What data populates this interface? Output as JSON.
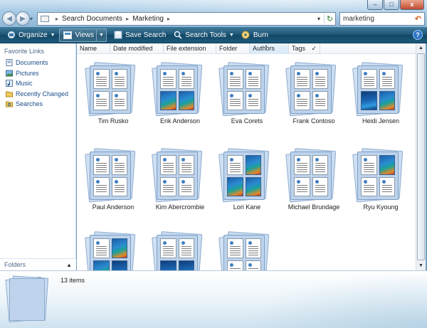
{
  "window": {
    "minimize": "–",
    "maximize": "□",
    "close": "x"
  },
  "address": {
    "crumbs": [
      "Search Documents",
      "Marketing"
    ],
    "separator": "▸"
  },
  "search": {
    "value": "marketing",
    "clear_glyph": "↶"
  },
  "toolbar": {
    "organize": "Organize",
    "views": "Views",
    "save_search": "Save Search",
    "search_tools": "Search Tools",
    "burn": "Burn",
    "help": "?"
  },
  "nav": {
    "header": "Favorite Links",
    "items": [
      {
        "label": "Documents",
        "icon": "documents-icon"
      },
      {
        "label": "Pictures",
        "icon": "pictures-icon"
      },
      {
        "label": "Music",
        "icon": "music-icon"
      },
      {
        "label": "Recently Changed",
        "icon": "recently-changed-icon"
      },
      {
        "label": "Searches",
        "icon": "searches-icon"
      }
    ],
    "folders_label": "Folders",
    "folders_chevron": "▲"
  },
  "columns": [
    "Name",
    "Date modified",
    "File extension",
    "Folder",
    "Authors",
    "Tags"
  ],
  "tags_check": "✓",
  "items": [
    {
      "name": "Tim Rusko",
      "pages": [
        "doc",
        "doc",
        "doc",
        "doc"
      ]
    },
    {
      "name": "Erik Anderson",
      "pages": [
        "doc",
        "doc",
        "pic",
        "pic"
      ]
    },
    {
      "name": "Eva Corets",
      "pages": [
        "doc",
        "doc",
        "doc",
        "doc"
      ]
    },
    {
      "name": "Frank Contoso",
      "pages": [
        "doc",
        "doc",
        "doc",
        "doc"
      ]
    },
    {
      "name": "Heidi Jensen",
      "pages": [
        "doc",
        "doc",
        "pic2",
        "pic"
      ]
    },
    {
      "name": "Paul Anderson",
      "pages": [
        "doc",
        "doc",
        "doc",
        "doc"
      ]
    },
    {
      "name": "Kim Abercrombie",
      "pages": [
        "doc",
        "doc",
        "doc",
        "doc"
      ]
    },
    {
      "name": "Lori Kane",
      "pages": [
        "doc",
        "pic",
        "pic",
        "pic"
      ]
    },
    {
      "name": "Michael Brundage",
      "pages": [
        "doc",
        "doc",
        "doc",
        "doc"
      ]
    },
    {
      "name": "Ryu Kyoung",
      "pages": [
        "doc",
        "pic",
        "doc",
        "doc"
      ]
    },
    {
      "name": "",
      "pages": [
        "doc",
        "pic",
        "pic",
        "pic2"
      ]
    },
    {
      "name": "",
      "pages": [
        "doc",
        "doc",
        "pic2",
        "pic2"
      ]
    },
    {
      "name": "",
      "pages": [
        "doc",
        "doc",
        "doc",
        "doc"
      ]
    }
  ],
  "details": {
    "count": "13 items"
  }
}
